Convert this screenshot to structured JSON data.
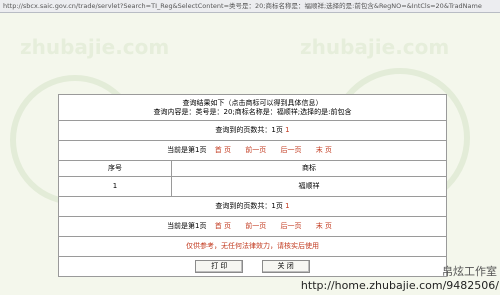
{
  "address_bar": {
    "url": "http://sbcx.saic.gov.cn/trade/servlet?Search=TI_Reg&SelectContent=类号是：20;商标名称是：福顺祥;选择的是:前包含&RegNO=&IntCls=20&TradName"
  },
  "result": {
    "heading": "查询结果如下（点击商标可以得到具体信息）",
    "query_line": "查询内容是：类号是：20;商标名称是：福顺祥;选择的是:前包含",
    "total_pages_label": "查询到的页数共：1页",
    "total_pages_value": "1",
    "current_page_label": "当前是第1页",
    "nav": {
      "first": "首 页",
      "prev": "前一页",
      "next": "后一页",
      "last": "末 页"
    },
    "columns": [
      "序号",
      "商标"
    ],
    "rows": [
      {
        "index": "1",
        "mark": "福顺祥"
      }
    ],
    "notice": "仅供参考，无任何法律效力，请核实后使用",
    "print_button": "打 印",
    "close_button": "关 闭"
  },
  "watermark": {
    "text": "zhubajie.com"
  },
  "footer": {
    "brand": "帛炫工作室",
    "url": "http://home.zhubajie.com/9482506/"
  }
}
